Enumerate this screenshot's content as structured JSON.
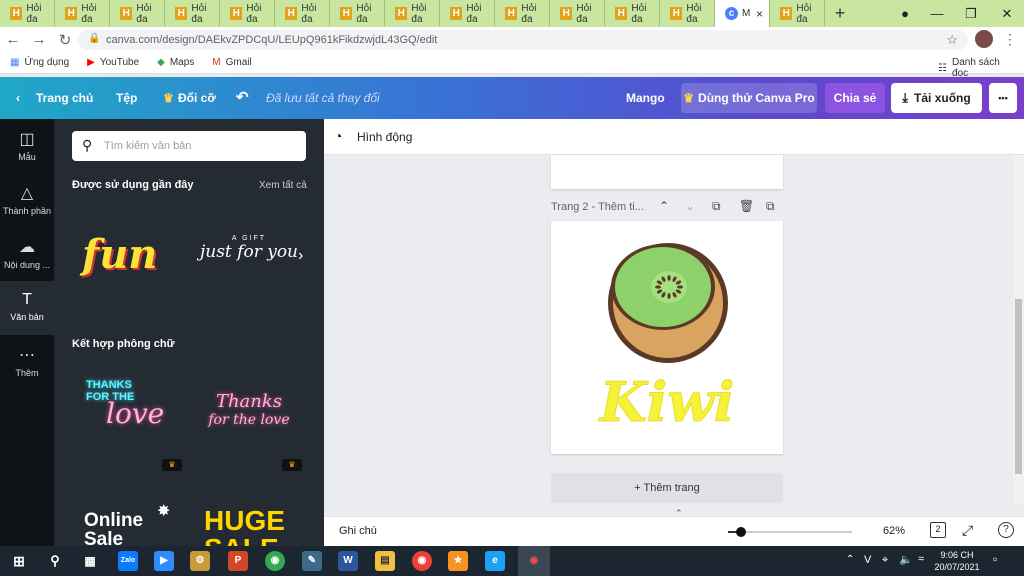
{
  "browser": {
    "tabs": [
      {
        "label": "Hỏi đa"
      },
      {
        "label": "Hỏi đa"
      },
      {
        "label": "Hỏi đa"
      },
      {
        "label": "Hỏi đa"
      },
      {
        "label": "Hỏi đa"
      },
      {
        "label": "Hỏi đa"
      },
      {
        "label": "Hỏi đa"
      },
      {
        "label": "Hỏi đa"
      },
      {
        "label": "Hỏi đa"
      },
      {
        "label": "Hỏi đa"
      },
      {
        "label": "Hỏi đa"
      },
      {
        "label": "Hỏi đa"
      },
      {
        "label": "Hỏi đa"
      }
    ],
    "active_tab": {
      "label": "M",
      "close": "×"
    },
    "after_tab": {
      "label": "Hỏi đa"
    },
    "new_tab": "+",
    "url": "canva.com/design/DAEkvZPDCqU/LEUpQ961kFikdzwjdL43GQ/edit",
    "bookmarks": [
      {
        "label": "Ứng dụng",
        "icon": "apps-icon"
      },
      {
        "label": "YouTube",
        "icon": "youtube-icon"
      },
      {
        "label": "Maps",
        "icon": "maps-icon"
      },
      {
        "label": "Gmail",
        "icon": "gmail-icon"
      }
    ],
    "reading_list": "Danh sách đọc"
  },
  "header": {
    "home": "Trang chủ",
    "file": "Tệp",
    "resize": "Đổi cỡ",
    "saved": "Đã lưu tất cả thay đổi",
    "design_name": "Mango",
    "try_pro": "Dùng thử Canva Pro",
    "share": "Chia sẻ",
    "download": "Tải xuống",
    "more": "•••"
  },
  "rail": [
    {
      "label": "Mẫu",
      "icon": "template-icon"
    },
    {
      "label": "Thành phần",
      "icon": "elements-icon"
    },
    {
      "label": "Nội dung ...",
      "icon": "upload-icon"
    },
    {
      "label": "Văn bản",
      "icon": "text-icon"
    },
    {
      "label": "Thêm",
      "icon": "more-icon"
    }
  ],
  "panel": {
    "search_placeholder": "Tìm kiếm văn bản",
    "recent_title": "Được sử dụng gần đây",
    "see_all": "Xem tất cả",
    "recent_items": [
      {
        "text": "fun"
      },
      {
        "top": "A GIFT",
        "text": "just for you"
      }
    ],
    "combo_title": "Kết hợp phông chữ",
    "combos": [
      {
        "line1": "THANKS",
        "line2": "FOR THE",
        "line3": "love"
      },
      {
        "line1": "Thanks",
        "line2": "for the love"
      },
      {
        "line1": "Online",
        "line2": "Sale"
      },
      {
        "line1": "HUGE",
        "line2": "SALE"
      }
    ]
  },
  "editor": {
    "animate": "Hình động",
    "page_label": "Trang 2 - Thêm ti...",
    "artwork_text": "Kiwi",
    "add_page": "+ Thêm trang",
    "notes": "Ghi chú",
    "zoom_value": 62,
    "zoom": "62%",
    "page_count": "2",
    "help": "?"
  },
  "taskbar": {
    "time": "9:06 CH",
    "date": "20/07/2021",
    "lang": "V"
  },
  "colors": {
    "header_start": "#1fa8c7",
    "header_end": "#7b3fcb",
    "pro_button": "#8c54e0",
    "kiwi_text": "#f6f23a",
    "kiwi_flesh": "#8ed06a",
    "kiwi_skin": "#d9a45f"
  }
}
